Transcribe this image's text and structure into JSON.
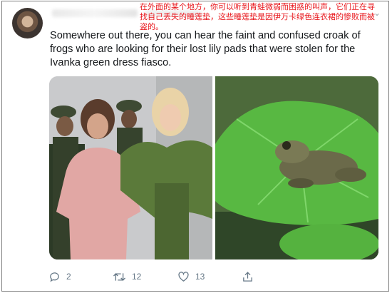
{
  "tweet": {
    "translation": "在外面的某个地方，你可以听到青蛙微弱而困惑的叫声，它们正在寻找自己丢失的睡莲垫，这些睡莲垫是因伊万卡绿色连衣裙的惨败而被盗的。",
    "text": "Somewhere out there, you can hear the faint and confused croak of frogs who are looking for their lost lily pads that were stolen for the Ivanka green dress fiasco."
  },
  "actions": {
    "replies": "2",
    "retweets": "12",
    "likes": "13"
  },
  "icons": {
    "reply": "reply-icon",
    "retweet": "retweet-icon",
    "like": "heart-icon",
    "share": "share-icon",
    "caret": "chevron-down-icon"
  },
  "colors": {
    "translation_text": "#e8141a",
    "body_text": "#14171a",
    "meta_text": "#657786"
  }
}
